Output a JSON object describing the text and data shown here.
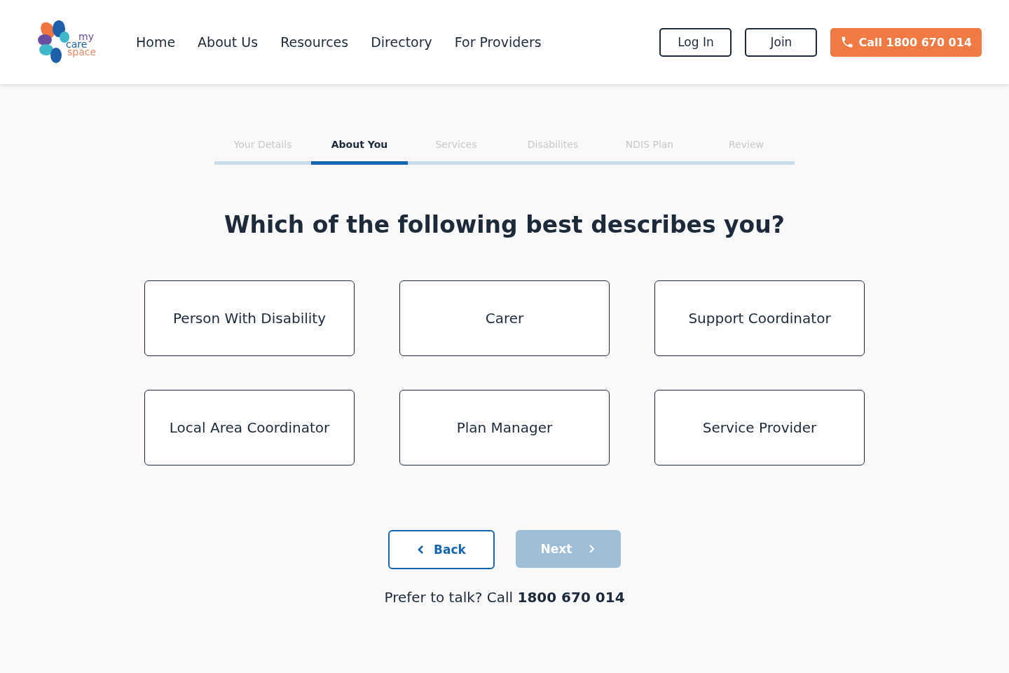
{
  "logo": {
    "words": [
      "my",
      "care",
      "space"
    ]
  },
  "nav": [
    "Home",
    "About Us",
    "Resources",
    "Directory",
    "For Providers"
  ],
  "header_buttons": {
    "login": "Log In",
    "join": "Join",
    "call": "Call 1800 670 014"
  },
  "steps": [
    {
      "label": "Your Details",
      "selected": false
    },
    {
      "label": "About You",
      "selected": true
    },
    {
      "label": "Services",
      "selected": false
    },
    {
      "label": "Disabilites",
      "selected": false
    },
    {
      "label": "NDIS Plan",
      "selected": false
    },
    {
      "label": "Review",
      "selected": false
    }
  ],
  "heading": "Which of the following best describes you?",
  "options": [
    {
      "label": "Person With Disability",
      "selected": false
    },
    {
      "label": "Carer",
      "selected": false
    },
    {
      "label": "Support Coordinator",
      "selected": false
    },
    {
      "label": "Local Area Coordinator",
      "selected": false
    },
    {
      "label": "Plan Manager",
      "selected": false
    },
    {
      "label": "Service Provider",
      "selected": false
    }
  ],
  "back": {
    "label": "Back"
  },
  "next": {
    "label": "Next",
    "disabled": true
  },
  "footer": "Prefer to talk? Call **1800 670 014**"
}
